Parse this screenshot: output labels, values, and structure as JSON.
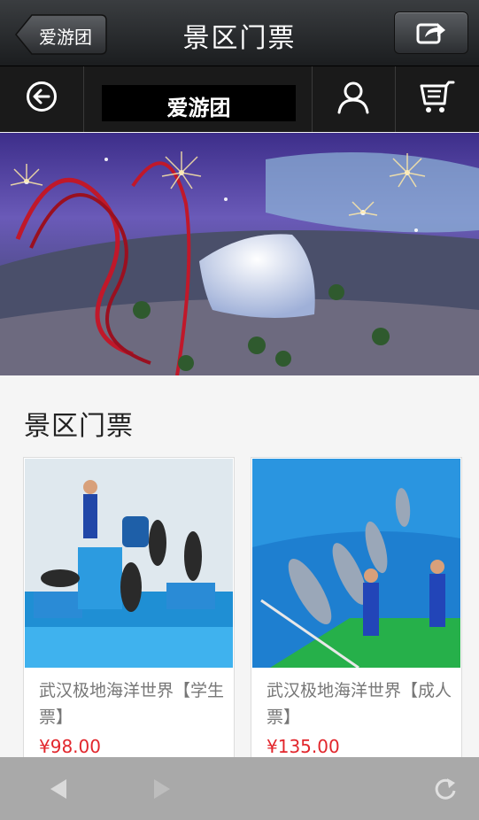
{
  "header": {
    "back_label": "爱游团",
    "title": "景区门票",
    "share_icon": "share-icon"
  },
  "nav": {
    "back_icon": "back-circle-icon",
    "logo_text": "爱游团",
    "user_icon": "user-icon",
    "cart_icon": "cart-icon"
  },
  "section": {
    "title": "景区门票"
  },
  "products": [
    {
      "name": "武汉极地海洋世界【学生票】",
      "price": "¥98.00"
    },
    {
      "name": "武汉极地海洋世界【成人票】",
      "price": "¥135.00"
    }
  ],
  "toolbar": {
    "back_icon": "triangle-left-icon",
    "forward_icon": "triangle-right-icon",
    "refresh_icon": "refresh-icon"
  }
}
